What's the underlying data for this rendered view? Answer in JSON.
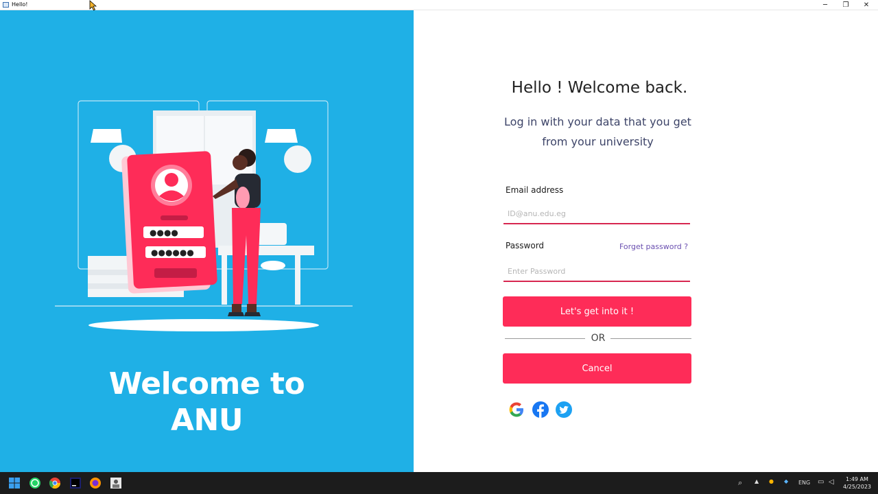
{
  "window": {
    "title": "Hello!",
    "controls": {
      "minimize": "─",
      "maximize": "❐",
      "close": "✕"
    }
  },
  "left_panel": {
    "background": "#1fb0e6",
    "welcome_line1": "Welcome to",
    "welcome_line2": "ANU",
    "illustration_icon": "login-illustration",
    "pin_dots_1": "●●●●",
    "pin_dots_2": "●●●●●●"
  },
  "form": {
    "heading": "Hello ! Welcome back.",
    "subtitle_line1": "Log in with your data that you get",
    "subtitle_line2": "from your university",
    "email_label": "Email address",
    "email_placeholder": "ID@anu.edu.eg",
    "email_value": "",
    "password_label": "Password",
    "forgot_link": "Forget password ?",
    "password_placeholder": "Enter Password",
    "password_value": "",
    "submit_label": "Let's get into it !",
    "or_text": "OR",
    "cancel_label": "Cancel",
    "accent_color": "#fe2c58",
    "social": [
      "google-icon",
      "facebook-icon",
      "twitter-icon"
    ]
  },
  "taskbar": {
    "apps": [
      "windows-start-icon",
      "whatsapp-icon",
      "chrome-icon",
      "jetbrains-icon",
      "firefox-icon",
      "app-icon"
    ],
    "tray_lang": "ENG",
    "time": "1:49 AM",
    "date": "4/25/2023"
  }
}
